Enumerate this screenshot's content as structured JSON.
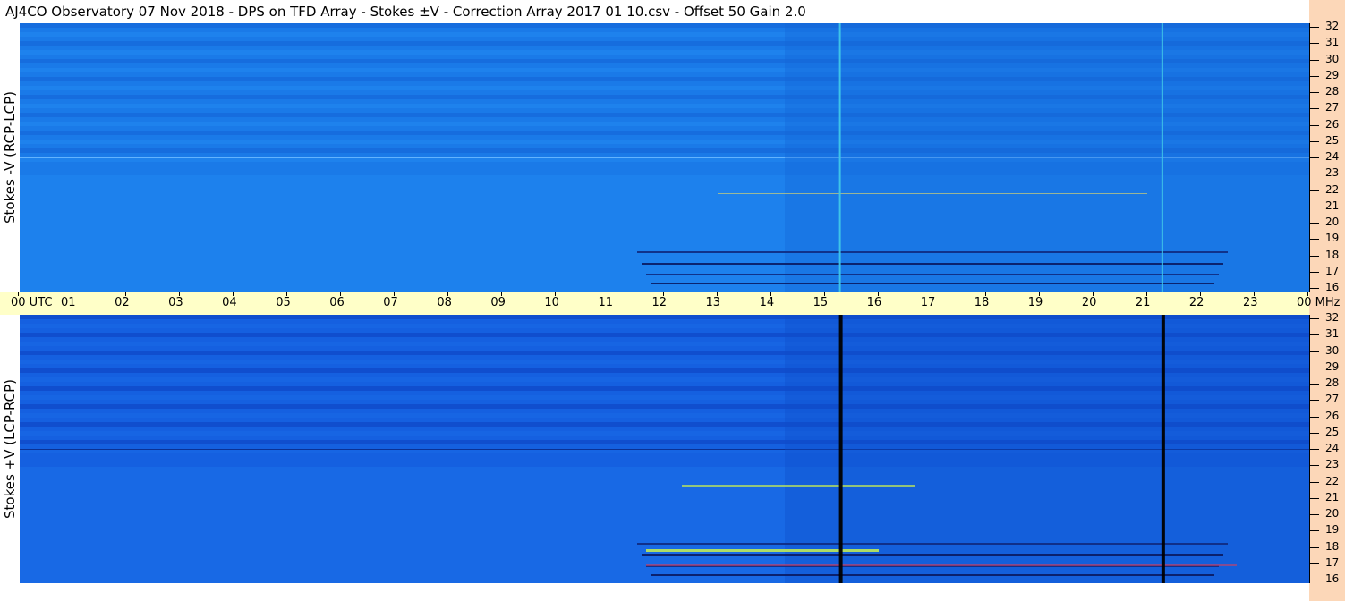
{
  "title": "AJ4CO Observatory  07 Nov 2018  -  DPS on TFD Array  -  Stokes ±V  -  Correction Array 2017 01 10.csv  -  Offset 50  Gain 2.0",
  "panels": {
    "top_label": "Stokes -V  (RCP-LCP)",
    "bottom_label": "Stokes +V  (LCP-RCP)"
  },
  "time_axis": {
    "labels": [
      "00  UTC",
      "01",
      "02",
      "03",
      "04",
      "05",
      "06",
      "07",
      "08",
      "09",
      "10",
      "11",
      "12",
      "13",
      "14",
      "15",
      "16",
      "17",
      "18",
      "19",
      "20",
      "21",
      "22",
      "23",
      "00 MHz"
    ]
  },
  "freq_axis": {
    "labels": [
      "32",
      "31",
      "30",
      "29",
      "28",
      "27",
      "26",
      "25",
      "24",
      "23",
      "22",
      "21",
      "20",
      "19",
      "18",
      "17",
      "16"
    ]
  },
  "colors": {
    "background": "#1f78e6",
    "utc_bar": "#ffffc8",
    "right_strip": "#fcd7b8"
  }
}
